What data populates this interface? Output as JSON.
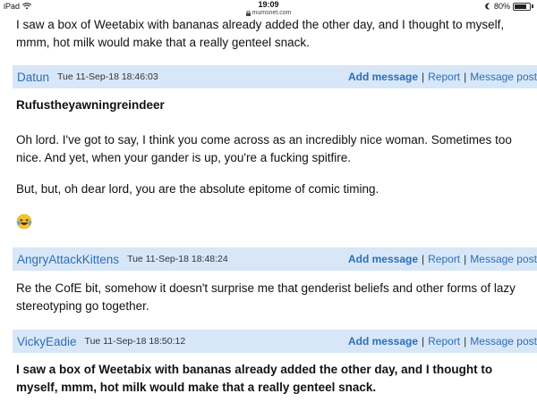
{
  "status_bar": {
    "device": "iPad",
    "time": "19:09",
    "url": "mumsnet.com",
    "battery": "80%",
    "battery_level": 0.8
  },
  "top_text": "I saw a box of Weetabix with bananas already added the other day, and I thought to myself, mmm, hot milk would make that a really genteel snack.",
  "actions": {
    "add": "Add message",
    "report": "Report",
    "post": "Message post"
  },
  "posts": [
    {
      "author": "Datun",
      "time": "Tue 11-Sep-18 18:46:03",
      "quote_author": "Rufustheyawningreindeer",
      "p1": "Oh lord. I've got to say, I think you come across as an incredibly nice woman. Sometimes too nice. And yet, when your gander is up, you're a fucking spitfire.",
      "p2": "But, but, oh dear lord, you are the absolute epitome of comic timing.",
      "emoji_icon": "laughing-crying-emoji"
    },
    {
      "author": "AngryAttackKittens",
      "time": "Tue 11-Sep-18 18:48:24",
      "p1": "Re the CofE bit, somehow it doesn't surprise me that genderist beliefs and other forms of lazy stereotyping go together."
    },
    {
      "author": "VickyEadie",
      "time": "Tue 11-Sep-18 18:50:12",
      "p1": "I saw a box of Weetabix with bananas already added the other day, and I thought to myself, mmm, hot milk would make that a really genteel snack."
    }
  ],
  "colors": {
    "header_bg": "#d8e7f8",
    "link": "#2c6eb7"
  }
}
